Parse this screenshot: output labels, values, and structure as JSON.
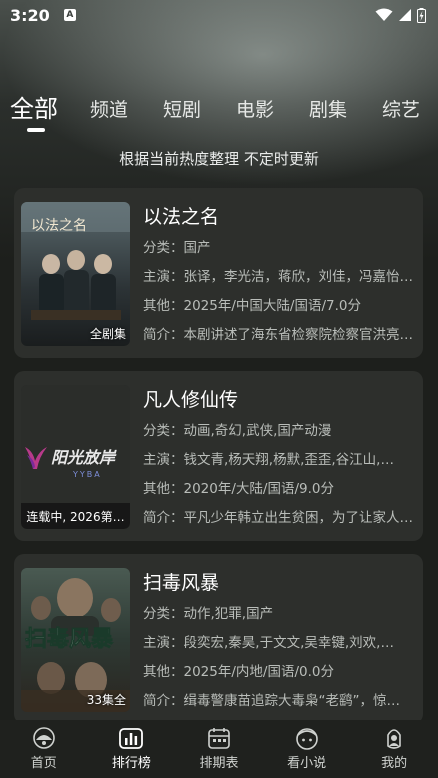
{
  "status": {
    "time": "3:20",
    "a_glyph": "A"
  },
  "tabs": [
    "全部",
    "频道",
    "短剧",
    "电影",
    "剧集",
    "综艺"
  ],
  "subtitle": "根据当前热度整理 不定时更新",
  "items": [
    {
      "title": "以法之名",
      "category": "分类：国产",
      "cast": "主演：张译，李光洁，蒋欣，刘佳，冯嘉怡，…",
      "other": "其他：2025年/中国大陆/国语/7.0分",
      "intro": "简介：本剧讲述了海东省检察院检察官洪亮…",
      "badge": "全剧集",
      "poster_text": "以法之名"
    },
    {
      "title": "凡人修仙传",
      "category": "分类：动画,奇幻,武侠,国产动漫",
      "cast": "主演：钱文青,杨天翔,杨默,歪歪,谷江山,…",
      "other": "其他：2020年/大陆/国语/9.0分",
      "intro": "简介：平凡少年韩立出生贫困，为了让家人…",
      "badge": "连载中, 2026第…",
      "poster_logo": "阳光放岸",
      "poster_logo_sub": "YYBA"
    },
    {
      "title": "扫毒风暴",
      "category": "分类：动作,犯罪,国产",
      "cast": "主演：段奕宏,秦昊,于文文,吴幸键,刘欢,…",
      "other": "其他：2025年/内地/国语/0.0分",
      "intro": "简介：缉毒警康苗追踪大毒枭“老鹞”，惊…",
      "badge": "33集全",
      "poster_text": "扫毒风暴"
    }
  ],
  "nav": [
    "首页",
    "排行榜",
    "排期表",
    "看小说",
    "我的"
  ]
}
